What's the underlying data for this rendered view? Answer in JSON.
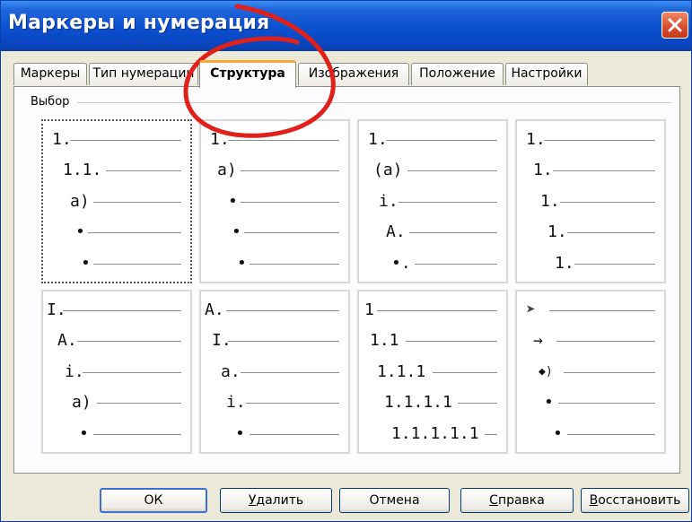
{
  "window": {
    "title": "Маркеры и нумерация",
    "colors": {
      "titlebar": "#0b50cf",
      "face": "#ece9d8",
      "close": "#d94b2b",
      "active_tab_accent": "#f3a93a",
      "annotation": "#e0201b"
    }
  },
  "tabs": [
    {
      "label": "Маркеры",
      "active": false
    },
    {
      "label": "Тип нумерации",
      "active": false
    },
    {
      "label": "Структура",
      "active": true
    },
    {
      "label": "Изображения",
      "active": false
    },
    {
      "label": "Положение",
      "active": false
    },
    {
      "label": "Настройки",
      "active": false
    }
  ],
  "group": {
    "label": "Выбор"
  },
  "presets": [
    {
      "rows": [
        "1.",
        "1.1.",
        "а)",
        "•",
        "•"
      ],
      "selected": true
    },
    {
      "rows": [
        "1.",
        "а)",
        "•",
        "•",
        "•"
      ],
      "selected": false
    },
    {
      "rows": [
        "1.",
        "(а)",
        "i.",
        "A.",
        "•."
      ],
      "selected": false
    },
    {
      "rows": [
        "1.",
        "1.",
        "1.",
        "1.",
        "1."
      ],
      "selected": false
    },
    {
      "rows": [
        "I.",
        "A.",
        "i.",
        "а)",
        "•"
      ],
      "selected": false
    },
    {
      "rows": [
        "A.",
        "I.",
        "a.",
        "i.",
        "•"
      ],
      "selected": false
    },
    {
      "rows": [
        "1",
        "1.1",
        "1.1.1",
        "1.1.1.1",
        "1.1.1.1.1"
      ],
      "selected": false
    },
    {
      "rows": [
        "➤",
        "→",
        "◆)",
        "•",
        "•"
      ],
      "selected": false
    }
  ],
  "buttons": {
    "ok": "ОК",
    "delete_mn": "У",
    "delete_rest": "далить",
    "cancel": "Отмена",
    "help_mn": "С",
    "help_rest": "правка",
    "reset_mn": "В",
    "reset_rest": "осстановить"
  }
}
